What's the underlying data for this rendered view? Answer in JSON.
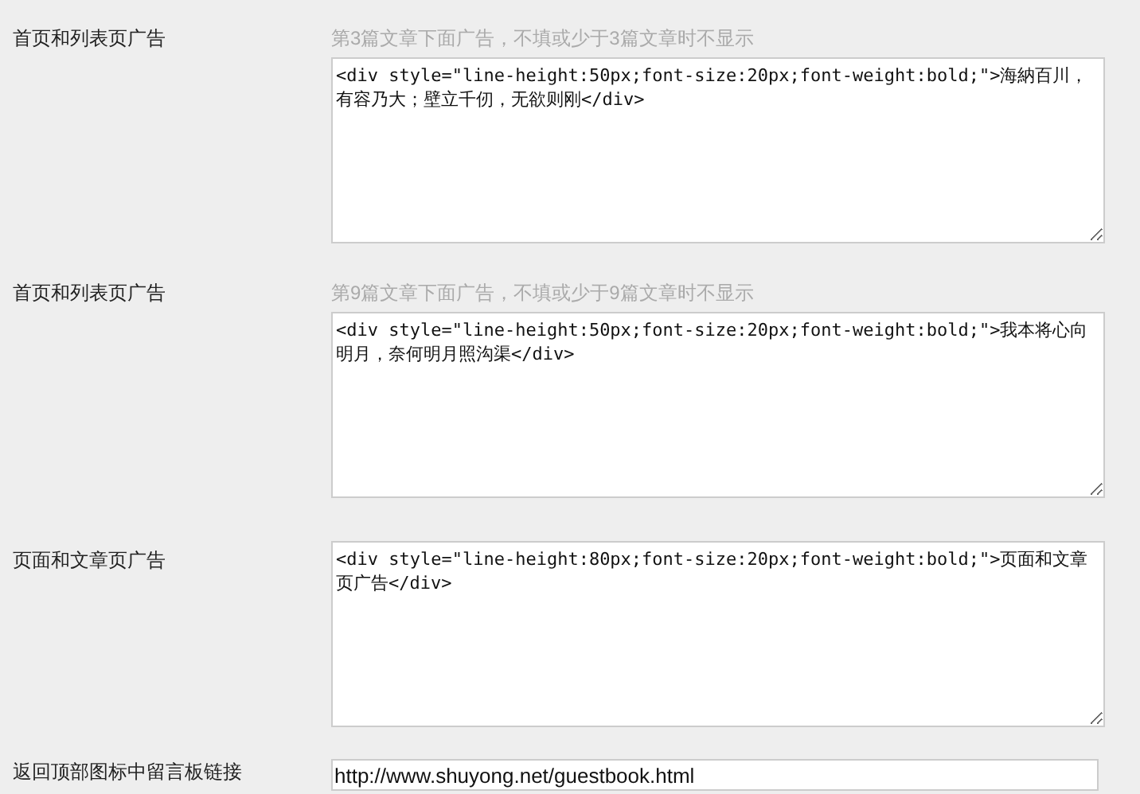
{
  "fields": [
    {
      "kind": "textarea",
      "label": "首页和列表页广告",
      "hint": "第3篇文章下面广告，不填或少于3篇文章时不显示",
      "value": "<div style=\"line-height:50px;font-size:20px;font-weight:bold;\">海納百川，有容乃大；壁立千仞，无欲则刚</div>"
    },
    {
      "kind": "textarea",
      "label": "首页和列表页广告",
      "hint": "第9篇文章下面广告，不填或少于9篇文章时不显示",
      "value": "<div style=\"line-height:50px;font-size:20px;font-weight:bold;\">我本将心向明月，奈何明月照沟渠</div>"
    },
    {
      "kind": "textarea",
      "label": "页面和文章页广告",
      "value": "<div style=\"line-height:80px;font-size:20px;font-weight:bold;\">页面和文章页广告</div>"
    },
    {
      "kind": "input",
      "label": "返回顶部图标中留言板链接",
      "value": "http://www.shuyong.net/guestbook.html"
    }
  ]
}
